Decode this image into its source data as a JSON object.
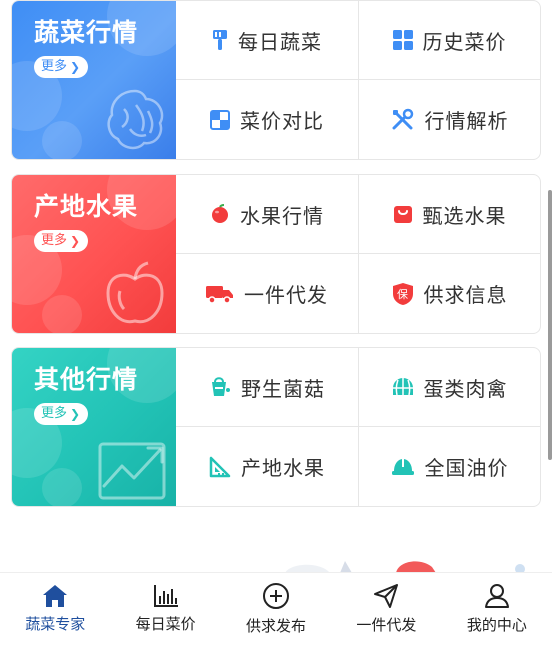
{
  "categories": [
    {
      "title": "蔬菜行情",
      "more_label": "更多",
      "items": [
        {
          "label": "每日蔬菜",
          "icon": "brush-icon"
        },
        {
          "label": "历史菜价",
          "icon": "grid-icon"
        },
        {
          "label": "菜价对比",
          "icon": "compare-icon"
        },
        {
          "label": "行情解析",
          "icon": "tools-icon"
        }
      ]
    },
    {
      "title": "产地水果",
      "more_label": "更多",
      "items": [
        {
          "label": "水果行情",
          "icon": "apple-icon"
        },
        {
          "label": "甄选水果",
          "icon": "bag-icon"
        },
        {
          "label": "一件代发",
          "icon": "truck-icon"
        },
        {
          "label": "供求信息",
          "icon": "shield-icon",
          "badge": "保"
        }
      ]
    },
    {
      "title": "其他行情",
      "more_label": "更多",
      "items": [
        {
          "label": "野生菌菇",
          "icon": "paint-bucket-icon"
        },
        {
          "label": "蛋类肉禽",
          "icon": "globe-icon"
        },
        {
          "label": "产地水果",
          "icon": "set-square-icon"
        },
        {
          "label": "全国油价",
          "icon": "helmet-icon"
        }
      ]
    }
  ],
  "tabbar": [
    {
      "label": "蔬菜专家",
      "icon": "home-icon",
      "active": true
    },
    {
      "label": "每日菜价",
      "icon": "bar-chart-icon",
      "active": false
    },
    {
      "label": "供求发布",
      "icon": "plus-circle-icon",
      "active": false
    },
    {
      "label": "一件代发",
      "icon": "send-icon",
      "active": false
    },
    {
      "label": "我的中心",
      "icon": "user-icon",
      "active": false
    }
  ],
  "colors": {
    "vegetable_accent": "#3f8ef5",
    "fruit_accent": "#ff5252",
    "other_accent": "#22c3b6",
    "tab_active": "#1f4f9e"
  }
}
